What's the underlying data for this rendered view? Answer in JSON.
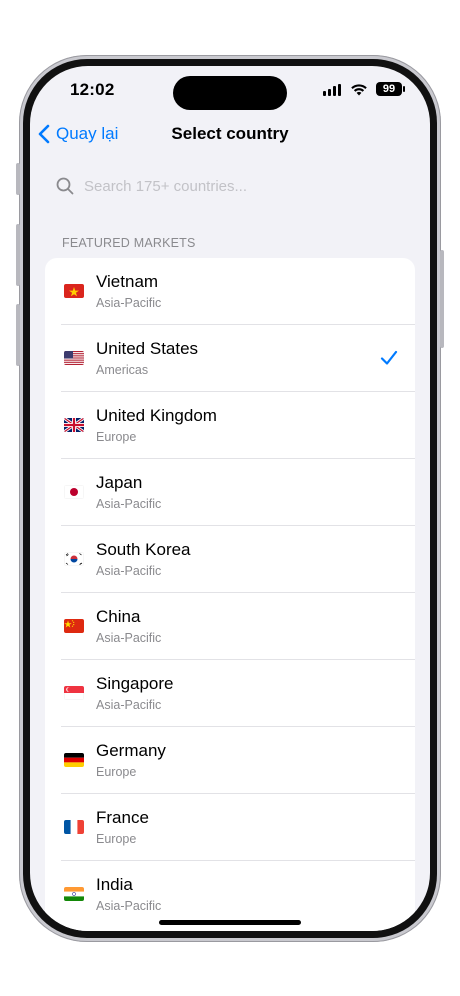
{
  "status_bar": {
    "time": "12:02",
    "battery": "99"
  },
  "nav": {
    "back_label": "Quay lại",
    "title": "Select country"
  },
  "search": {
    "placeholder": "Search 175+ countries..."
  },
  "section": {
    "header": "FEATURED MARKETS"
  },
  "countries": [
    {
      "name": "Vietnam",
      "region": "Asia-Pacific",
      "flag": "flag-vietnam-icon",
      "selected": false
    },
    {
      "name": "United States",
      "region": "Americas",
      "flag": "flag-united-states-icon",
      "selected": true
    },
    {
      "name": "United Kingdom",
      "region": "Europe",
      "flag": "flag-united-kingdom-icon",
      "selected": false
    },
    {
      "name": "Japan",
      "region": "Asia-Pacific",
      "flag": "flag-japan-icon",
      "selected": false
    },
    {
      "name": "South Korea",
      "region": "Asia-Pacific",
      "flag": "flag-south-korea-icon",
      "selected": false
    },
    {
      "name": "China",
      "region": "Asia-Pacific",
      "flag": "flag-china-icon",
      "selected": false
    },
    {
      "name": "Singapore",
      "region": "Asia-Pacific",
      "flag": "flag-singapore-icon",
      "selected": false
    },
    {
      "name": "Germany",
      "region": "Europe",
      "flag": "flag-germany-icon",
      "selected": false
    },
    {
      "name": "France",
      "region": "Europe",
      "flag": "flag-france-icon",
      "selected": false
    },
    {
      "name": "India",
      "region": "Asia-Pacific",
      "flag": "flag-india-icon",
      "selected": false
    }
  ],
  "colors": {
    "accent": "#007aff",
    "background": "#f2f2f7",
    "secondary_text": "#8a8a8e"
  }
}
